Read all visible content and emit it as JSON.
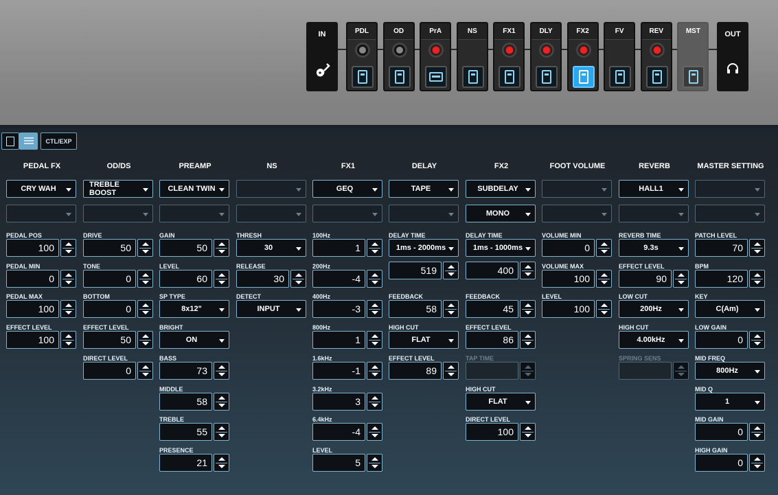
{
  "chain": {
    "in_label": "IN",
    "out_label": "OUT",
    "in_icon": "guitar-icon",
    "out_icon": "headphones-icon",
    "blocks": [
      {
        "label": "PDL",
        "led": "off",
        "switch": "pedal",
        "selected": false
      },
      {
        "label": "OD",
        "led": "off",
        "switch": "pedal",
        "selected": false
      },
      {
        "label": "PrA",
        "led": "on",
        "switch": "amp",
        "selected": false
      },
      {
        "label": "NS",
        "led": "none",
        "switch": "pedal",
        "selected": false
      },
      {
        "label": "FX1",
        "led": "on",
        "switch": "pedal",
        "selected": false
      },
      {
        "label": "DLY",
        "led": "on",
        "switch": "pedal",
        "selected": false
      },
      {
        "label": "FX2",
        "led": "on",
        "switch": "pedal",
        "selected": true
      },
      {
        "label": "FV",
        "led": "none",
        "switch": "pedal",
        "selected": false
      },
      {
        "label": "REV",
        "led": "on",
        "switch": "pedal",
        "selected": false
      },
      {
        "label": "MST",
        "led": "none",
        "switch": "pedal",
        "selected": false
      }
    ]
  },
  "toolbar": {
    "ctl_exp_label": "CTL/EXP",
    "active_view": "list"
  },
  "columns": [
    {
      "title": "PEDAL FX",
      "select1": "CRY WAH",
      "select2": "",
      "params": [
        {
          "label": "PEDAL POS",
          "type": "num",
          "value": "100"
        },
        {
          "label": "PEDAL MIN",
          "type": "num",
          "value": "0"
        },
        {
          "label": "PEDAL MAX",
          "type": "num",
          "value": "100"
        },
        {
          "label": "EFFECT LEVEL",
          "type": "num",
          "value": "100"
        }
      ]
    },
    {
      "title": "OD/DS",
      "select1": "TREBLE BOOST",
      "select2": "",
      "params": [
        {
          "label": "DRIVE",
          "type": "num",
          "value": "50"
        },
        {
          "label": "TONE",
          "type": "num",
          "value": "0"
        },
        {
          "label": "BOTTOM",
          "type": "num",
          "value": "0"
        },
        {
          "label": "EFFECT LEVEL",
          "type": "num",
          "value": "50"
        },
        {
          "label": "DIRECT LEVEL",
          "type": "num",
          "value": "0"
        }
      ]
    },
    {
      "title": "PREAMP",
      "select1": "CLEAN TWIN",
      "select2": "",
      "params": [
        {
          "label": "GAIN",
          "type": "num",
          "value": "50"
        },
        {
          "label": "LEVEL",
          "type": "num",
          "value": "60"
        },
        {
          "label": "SP TYPE",
          "type": "select",
          "value": "8x12\""
        },
        {
          "label": "BRIGHT",
          "type": "select",
          "value": "ON"
        },
        {
          "label": "BASS",
          "type": "num",
          "value": "73"
        },
        {
          "label": "MIDDLE",
          "type": "num",
          "value": "58"
        },
        {
          "label": "TREBLE",
          "type": "num",
          "value": "55"
        },
        {
          "label": "PRESENCE",
          "type": "num",
          "value": "21"
        }
      ]
    },
    {
      "title": "NS",
      "select1": "",
      "select2": "",
      "params": [
        {
          "label": "THRESH",
          "type": "select",
          "value": "30"
        },
        {
          "label": "RELEASE",
          "type": "num",
          "value": "30"
        },
        {
          "label": "DETECT",
          "type": "select",
          "value": "INPUT"
        }
      ]
    },
    {
      "title": "FX1",
      "select1": "GEQ",
      "select2": "",
      "params": [
        {
          "label": "100Hz",
          "type": "num",
          "value": "1"
        },
        {
          "label": "200Hz",
          "type": "num",
          "value": "-4"
        },
        {
          "label": "400Hz",
          "type": "num",
          "value": "-3"
        },
        {
          "label": "800Hz",
          "type": "num",
          "value": "1"
        },
        {
          "label": "1.6kHz",
          "type": "num",
          "value": "-1"
        },
        {
          "label": "3.2kHz",
          "type": "num",
          "value": "3"
        },
        {
          "label": "6.4kHz",
          "type": "num",
          "value": "-4"
        },
        {
          "label": "LEVEL",
          "type": "num",
          "value": "5"
        }
      ]
    },
    {
      "title": "DELAY",
      "select1": "TAPE",
      "select2": "",
      "params": [
        {
          "label": "DELAY TIME",
          "type": "select",
          "value": "1ms - 2000ms"
        },
        {
          "label": "",
          "type": "num",
          "value": "519"
        },
        {
          "label": "FEEDBACK",
          "type": "num",
          "value": "58"
        },
        {
          "label": "HIGH CUT",
          "type": "select",
          "value": "FLAT"
        },
        {
          "label": "EFFECT LEVEL",
          "type": "num",
          "value": "89"
        }
      ]
    },
    {
      "title": "FX2",
      "select1": "SUBDELAY",
      "select2": "MONO",
      "params": [
        {
          "label": "DELAY TIME",
          "type": "select",
          "value": "1ms - 1000ms"
        },
        {
          "label": "",
          "type": "num",
          "value": "400"
        },
        {
          "label": "FEEDBACK",
          "type": "num",
          "value": "45"
        },
        {
          "label": "EFFECT LEVEL",
          "type": "num",
          "value": "86"
        },
        {
          "label": "TAP TIME",
          "type": "num",
          "value": "",
          "disabled": true
        },
        {
          "label": "HIGH CUT",
          "type": "select",
          "value": "FLAT"
        },
        {
          "label": "DIRECT LEVEL",
          "type": "num",
          "value": "100"
        }
      ]
    },
    {
      "title": "FOOT VOLUME",
      "select1": "",
      "select2": "",
      "params": [
        {
          "label": "VOLUME MIN",
          "type": "num",
          "value": "0"
        },
        {
          "label": "VOLUME MAX",
          "type": "num",
          "value": "100"
        },
        {
          "label": "LEVEL",
          "type": "num",
          "value": "100"
        }
      ]
    },
    {
      "title": "REVERB",
      "select1": "HALL1",
      "select2": "",
      "params": [
        {
          "label": "REVERB TIME",
          "type": "select",
          "value": "9.3s"
        },
        {
          "label": "EFFECT LEVEL",
          "type": "num",
          "value": "90"
        },
        {
          "label": "LOW CUT",
          "type": "select",
          "value": "200Hz"
        },
        {
          "label": "HIGH CUT",
          "type": "select",
          "value": "4.00kHz"
        },
        {
          "label": "SPRING SENS",
          "type": "num",
          "value": "",
          "disabled": true
        }
      ]
    },
    {
      "title": "MASTER SETTING",
      "select1": "",
      "select2": "",
      "params": [
        {
          "label": "PATCH LEVEL",
          "type": "num",
          "value": "70"
        },
        {
          "label": "BPM",
          "type": "num",
          "value": "120"
        },
        {
          "label": "KEY",
          "type": "select",
          "value": "C(Am)"
        },
        {
          "label": "LOW GAIN",
          "type": "num",
          "value": "0"
        },
        {
          "label": "MID FREQ",
          "type": "select",
          "value": "800Hz"
        },
        {
          "label": "MID Q",
          "type": "select",
          "value": "1"
        },
        {
          "label": "MID GAIN",
          "type": "num",
          "value": "0"
        },
        {
          "label": "HIGH GAIN",
          "type": "num",
          "value": "0"
        }
      ]
    }
  ]
}
